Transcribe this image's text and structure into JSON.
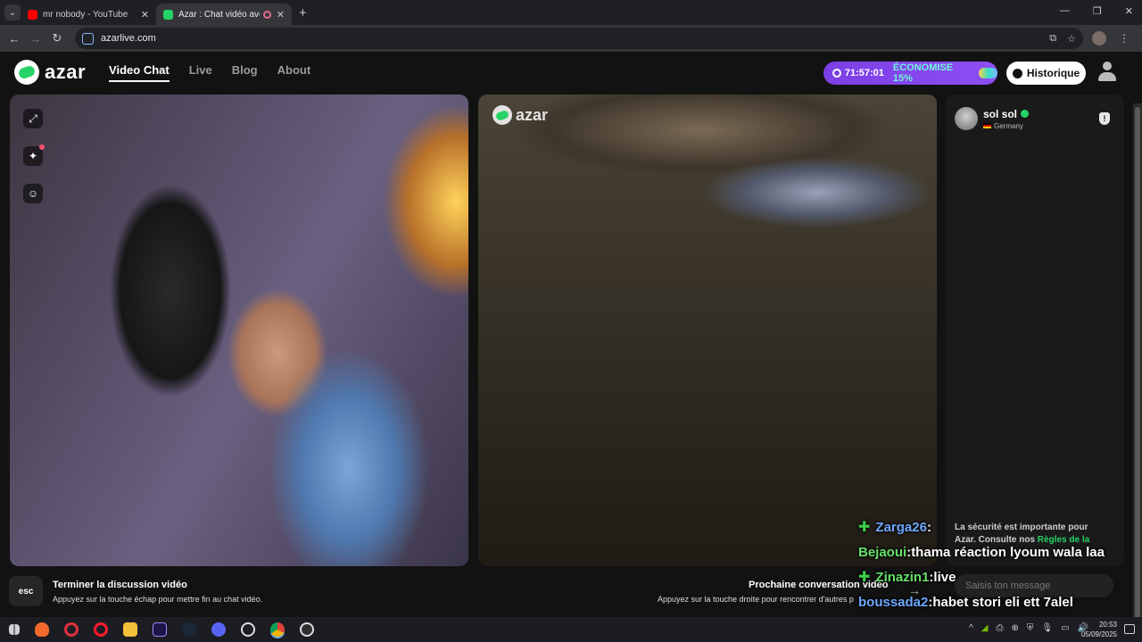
{
  "browser": {
    "tabs": [
      {
        "title": "mr nobody - YouTube",
        "favicon_color": "#ff0000"
      },
      {
        "title": "Azar : Chat vidéo avec de n",
        "favicon_color": "#25d366"
      }
    ],
    "new_tab": "+",
    "url": "azarlive.com"
  },
  "header": {
    "logo_text": "azar",
    "nav": [
      "Video Chat",
      "Live",
      "Blog",
      "About"
    ],
    "timer": "71:57:01",
    "savings": "ÉCONOMISE 15%",
    "history_label": "Historique"
  },
  "video_right": {
    "watermark": "azar"
  },
  "partner": {
    "name": "sol sol",
    "country": "Germany"
  },
  "safety_notice": {
    "text": "La sécurité est importante pour Azar. Consulte nos ",
    "link": "Règles de la"
  },
  "message_input": {
    "placeholder": "Saisis ton message"
  },
  "bottom": {
    "esc_key": "esc",
    "end_title": "Terminer la discussion vidéo",
    "end_sub": "Appuyez sur la touche échap pour mettre fin au chat vidéo.",
    "next_title": "Prochaine conversation vidéo",
    "next_sub": "Appuyez sur la touche droite pour rencontrer d'autres p"
  },
  "stream_chat": [
    {
      "user": "Zarga26",
      "sep": " : ",
      "text": "",
      "plus": true,
      "color": "blue"
    },
    {
      "user": "Bejaoui",
      "sep": " : ",
      "text": "thama réaction lyoum wala laa",
      "plus": false,
      "color": "green"
    },
    {
      "user": "Zinazin1",
      "sep": " : ",
      "text": "live",
      "plus": true,
      "color": "green"
    },
    {
      "user": "boussada2",
      "sep": " : ",
      "text": "habet stori eli ett 7alel",
      "plus": false,
      "color": "blue"
    }
  ],
  "taskbar": {
    "time": "20:53",
    "date": "05/09/2025"
  }
}
